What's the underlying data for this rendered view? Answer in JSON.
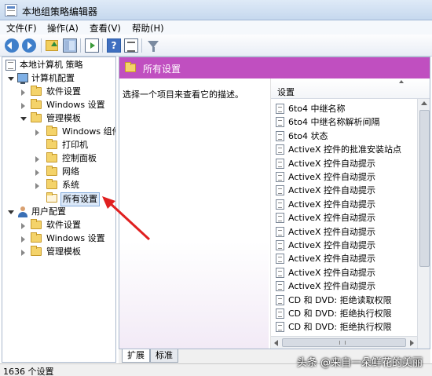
{
  "window": {
    "title": "本地组策略编辑器"
  },
  "menu": [
    "文件(F)",
    "操作(A)",
    "查看(V)",
    "帮助(H)"
  ],
  "toolbar": {
    "buttons": [
      "back-arrow-icon",
      "forward-arrow-icon",
      "up-folder-icon",
      "show-hide-tree-icon",
      "export-list-icon",
      "help-icon",
      "properties-icon",
      "filter-icon"
    ]
  },
  "tree": {
    "root": "本地计算机 策略",
    "computer_config": "计算机配置",
    "software_settings": "软件设置",
    "windows_settings": "Windows 设置",
    "admin_templates": "管理模板",
    "windows_components": "Windows 组件",
    "printers": "打印机",
    "control_panel": "控制面板",
    "network": "网络",
    "system": "系统",
    "all_settings": "所有设置",
    "user_config": "用户配置",
    "user_software_settings": "软件设置",
    "user_windows_settings": "Windows 设置",
    "user_admin_templates": "管理模板"
  },
  "detail": {
    "header": "所有设置",
    "description": "选择一个项目来查看它的描述。",
    "column_header": "设置",
    "rows": [
      "6to4 中继名称",
      "6to4 中继名称解析间隔",
      "6to4 状态",
      "ActiveX 控件的批准安装站点",
      "ActiveX 控件自动提示",
      "ActiveX 控件自动提示",
      "ActiveX 控件自动提示",
      "ActiveX 控件自动提示",
      "ActiveX 控件自动提示",
      "ActiveX 控件自动提示",
      "ActiveX 控件自动提示",
      "ActiveX 控件自动提示",
      "ActiveX 控件自动提示",
      "ActiveX 控件自动提示",
      "CD 和 DVD: 拒绝读取权限",
      "CD 和 DVD: 拒绝执行权限",
      "CD 和 DVD: 拒绝执行权限"
    ]
  },
  "tabs": [
    "扩展",
    "标准"
  ],
  "status": "1636 个设置",
  "watermark": "头条 @来自一朵鲜花的美丽",
  "colors": {
    "header_magenta": "#c04fc0",
    "arrow_red": "#e02020"
  }
}
